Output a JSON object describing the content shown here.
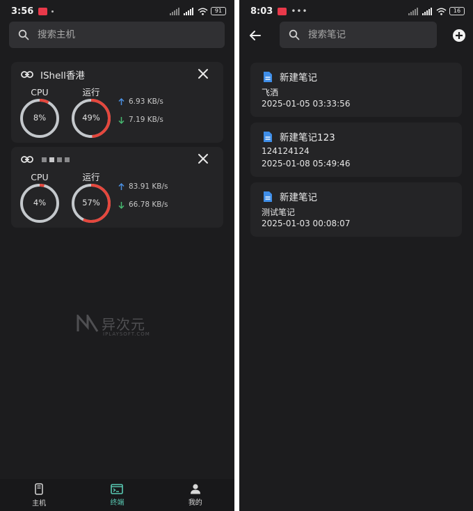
{
  "left": {
    "status": {
      "time": "3:56",
      "battery": "91"
    },
    "search": {
      "placeholder": "搜索主机"
    },
    "hosts": [
      {
        "name": "IShell香港",
        "cpu_label": "CPU",
        "cpu": "8%",
        "cpu_value": 8,
        "mem_label": "运行",
        "mem": "49%",
        "mem_value": 49,
        "up": "6.93 KB/s",
        "down": "7.19 KB/s"
      },
      {
        "name": "",
        "cpu_label": "CPU",
        "cpu": "4%",
        "cpu_value": 4,
        "mem_label": "运行",
        "mem": "57%",
        "mem_value": 57,
        "up": "83.91 KB/s",
        "down": "66.78 KB/s"
      }
    ],
    "watermark": {
      "main": "异次元",
      "sub": "IPLAYSOFT.COM"
    },
    "nav": [
      {
        "label": "主机",
        "icon": "phone-icon"
      },
      {
        "label": "终端",
        "icon": "terminal-icon"
      },
      {
        "label": "我的",
        "icon": "person-icon"
      }
    ]
  },
  "right": {
    "status": {
      "time": "8:03",
      "battery": "16"
    },
    "search": {
      "placeholder": "搜索笔记"
    },
    "notes": [
      {
        "title": "新建笔记",
        "body": "飞洒",
        "date": "2025-01-05 03:33:56"
      },
      {
        "title": "新建笔记123",
        "body": "124124124",
        "date": "2025-01-08 05:49:46"
      },
      {
        "title": "新建笔记",
        "body": "测试笔记",
        "date": "2025-01-03 00:08:07"
      }
    ]
  },
  "colors": {
    "accent": "#59c9b3",
    "gauge_red": "#e5473d",
    "gauge_track": "#c4c8cc",
    "upload_arrow": "#4a8fe0",
    "download_arrow": "#47b870",
    "note_icon": "#3f8ee8"
  }
}
